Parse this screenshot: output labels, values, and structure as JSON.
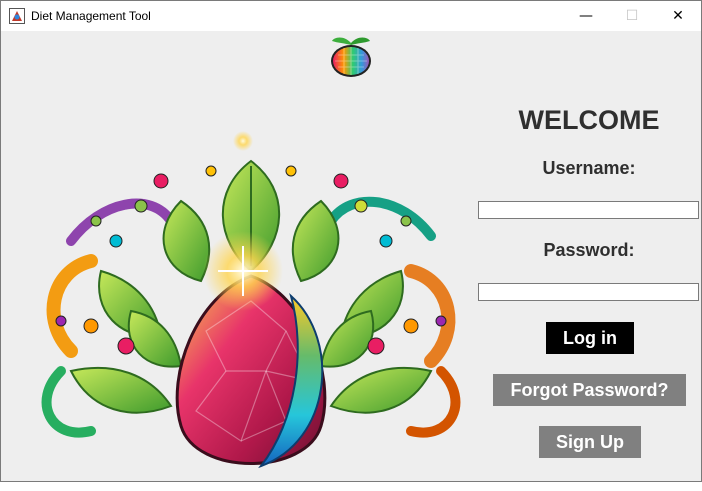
{
  "window": {
    "title": "Diet Management Tool",
    "controls": {
      "minimize": "—",
      "maximize": "☐",
      "close": "✕"
    }
  },
  "login": {
    "welcome": "WELCOME",
    "username_label": "Username:",
    "username_value": "",
    "password_label": "Password:",
    "password_value": "",
    "login_button": "Log in",
    "forgot_button": "Forgot Password?",
    "signup_button": "Sign Up"
  },
  "colors": {
    "background": "#eeeeee",
    "primary_button": "#000000",
    "secondary_button": "#808080",
    "text": "#2f2f2f"
  }
}
